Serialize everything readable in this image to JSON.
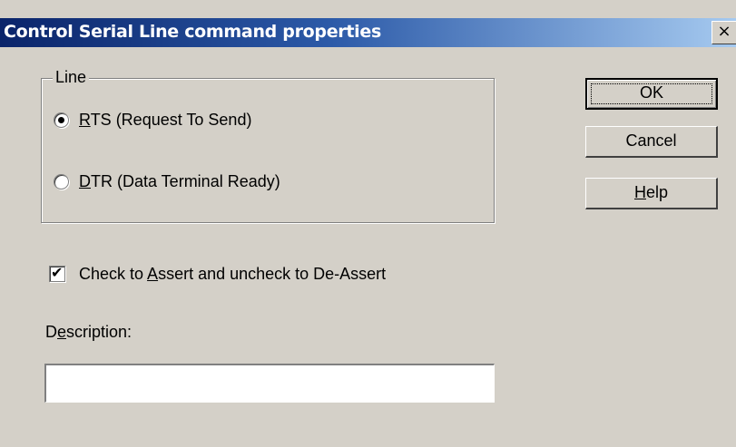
{
  "window": {
    "title": "Control Serial Line command properties",
    "close_glyph": "×",
    "title_gradient": [
      "#0a246a",
      "#a6caf0"
    ],
    "background": "#d4d0c8"
  },
  "line_group": {
    "label": "Line",
    "options": [
      {
        "accel": "R",
        "rest": "TS (Request To Send)",
        "selected": true
      },
      {
        "accel": "D",
        "rest": "TR (Data Terminal Ready)",
        "selected": false
      }
    ]
  },
  "assert_checkbox": {
    "prefix": "Check to ",
    "accel": "A",
    "rest": "ssert and uncheck to De-Assert",
    "checked": true
  },
  "description": {
    "prefix": "D",
    "accel": "e",
    "rest": "scription:",
    "value": ""
  },
  "buttons": {
    "ok": "OK",
    "cancel": "Cancel",
    "help_accel": "H",
    "help_rest": "elp"
  }
}
